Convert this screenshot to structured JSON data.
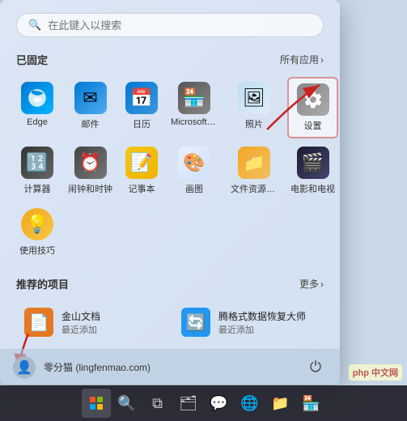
{
  "search": {
    "placeholder": "在此键入以搜索"
  },
  "pinned": {
    "section_title": "已固定",
    "all_apps_label": "所有应用",
    "chevron": "›",
    "apps": [
      {
        "id": "edge",
        "label": "Edge",
        "icon_class": "icon-edge",
        "icon_char": "🌐"
      },
      {
        "id": "mail",
        "label": "邮件",
        "icon_class": "icon-mail",
        "icon_char": "✉"
      },
      {
        "id": "calendar",
        "label": "日历",
        "icon_class": "icon-calendar",
        "icon_char": "📅"
      },
      {
        "id": "store",
        "label": "Microsoft Store",
        "icon_class": "icon-store",
        "icon_char": "🏪"
      },
      {
        "id": "photos",
        "label": "照片",
        "icon_class": "icon-photos",
        "icon_char": "🖼"
      },
      {
        "id": "settings",
        "label": "设置",
        "icon_class": "icon-settings",
        "icon_char": "⚙",
        "highlighted": true
      },
      {
        "id": "calc",
        "label": "计算器",
        "icon_class": "icon-calc",
        "icon_char": "🔢"
      },
      {
        "id": "clock",
        "label": "闹钟和时钟",
        "icon_class": "icon-clock",
        "icon_char": "⏰"
      },
      {
        "id": "notes",
        "label": "记事本",
        "icon_class": "icon-notes",
        "icon_char": "📝"
      },
      {
        "id": "paint",
        "label": "画图",
        "icon_class": "icon-paint",
        "icon_char": "🎨"
      },
      {
        "id": "files",
        "label": "文件资源管理器",
        "icon_class": "icon-files",
        "icon_char": "📁"
      },
      {
        "id": "movies",
        "label": "电影和电视",
        "icon_class": "icon-movies",
        "icon_char": "🎬"
      },
      {
        "id": "tips",
        "label": "使用技巧",
        "icon_class": "icon-tips",
        "icon_char": "💡"
      }
    ]
  },
  "recommended": {
    "section_title": "推荐的项目",
    "more_label": "更多",
    "chevron": "›",
    "items": [
      {
        "id": "jinshan",
        "name": "金山文档",
        "sub": "最近添加",
        "icon_char": "📄",
        "icon_bg": "#e87722"
      },
      {
        "id": "recuva",
        "name": "腾格式数据恢复大师",
        "sub": "最近添加",
        "icon_char": "🔄",
        "icon_bg": "#2196F3"
      }
    ]
  },
  "user_bar": {
    "username": "零分猫 (lingfenmao.com)",
    "power_icon": "⏻"
  },
  "taskbar": {
    "icons": [
      {
        "id": "start",
        "type": "start"
      },
      {
        "id": "search",
        "char": "🔍"
      },
      {
        "id": "taskview",
        "char": "⧉"
      },
      {
        "id": "widgets",
        "char": "🗂"
      },
      {
        "id": "chat",
        "char": "💬"
      },
      {
        "id": "edge-tb",
        "char": "🌐"
      },
      {
        "id": "explorer-tb",
        "char": "📁"
      },
      {
        "id": "store-tb",
        "char": "🏪"
      }
    ]
  },
  "watermark": {
    "text": "php 中文网"
  },
  "colors": {
    "accent": "#0078d4",
    "highlight_border": "#cc2222",
    "taskbar_bg": "rgba(20,20,35,0.92)"
  }
}
